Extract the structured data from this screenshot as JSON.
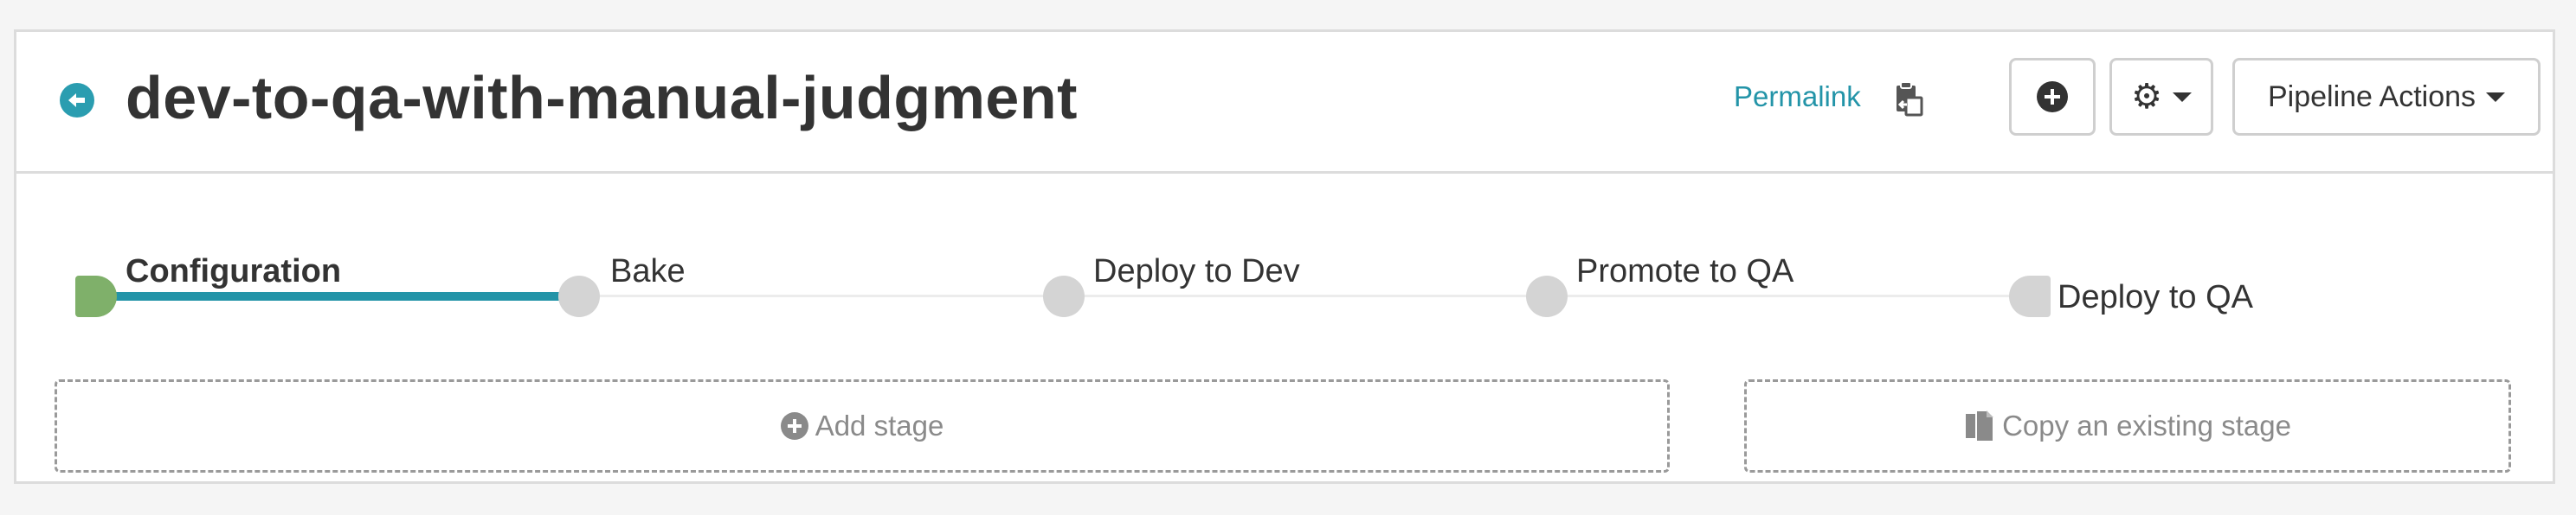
{
  "header": {
    "title": "dev-to-qa-with-manual-judgment",
    "permalink_label": "Permalink",
    "pipeline_actions_label": "Pipeline Actions",
    "icons": {
      "back": "back-arrow-circle-icon",
      "clipboard": "copy-to-clipboard-icon",
      "add": "plus-circle-icon",
      "settings": "gear-icon",
      "dropdown": "caret-down-icon"
    }
  },
  "stages": [
    {
      "label": "Configuration",
      "active": true
    },
    {
      "label": "Bake",
      "active": false
    },
    {
      "label": "Deploy to Dev",
      "active": false
    },
    {
      "label": "Promote to QA",
      "active": false
    },
    {
      "label": "Deploy to QA",
      "active": false
    }
  ],
  "actions": {
    "add_stage_label": "Add stage",
    "copy_stage_label": "Copy an existing stage"
  },
  "colors": {
    "accent": "#2394a8",
    "start_node": "#7fb06a",
    "inactive_node": "#d4d4d4"
  }
}
